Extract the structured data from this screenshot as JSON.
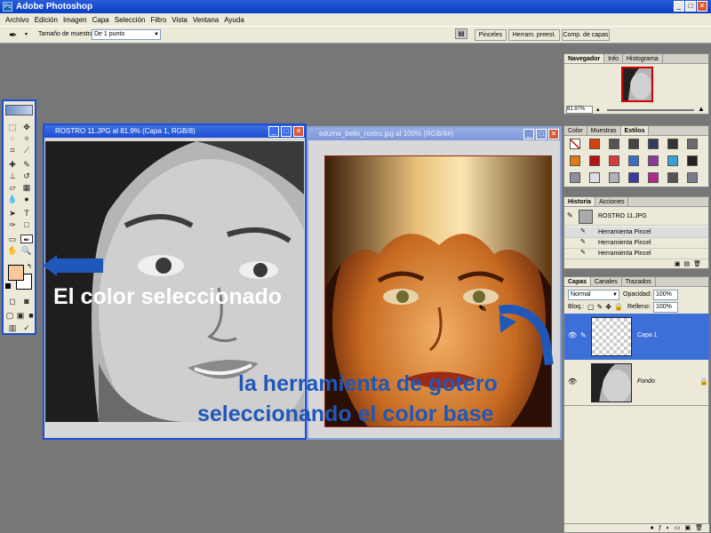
{
  "app": {
    "title": "Adobe Photoshop",
    "icon": "photoshop-icon"
  },
  "window_buttons": [
    "_",
    "□",
    "✕"
  ],
  "menu": [
    "Archivo",
    "Edición",
    "Imagen",
    "Capa",
    "Selección",
    "Filtro",
    "Vista",
    "Ventana",
    "Ayuda"
  ],
  "options": {
    "sample_label": "Tamaño de muestra:",
    "sample_value": "De 1 punto"
  },
  "palette_well": [
    "Pinceles",
    "Herram. preest.",
    "Comp. de capas"
  ],
  "docs": [
    {
      "title": "ROSTRO 11.JPG al 81.9% (Capa 1, RGB/8)"
    },
    {
      "title": "edurne_bello_rostro.jpg al 100% (RGB/8#)"
    }
  ],
  "navigator": {
    "tabs": [
      "Navegador",
      "Info",
      "Histograma"
    ],
    "zoom": "81.97%"
  },
  "styles": {
    "tabs": [
      "Color",
      "Muestras",
      "Estilos"
    ]
  },
  "history": {
    "tabs": [
      "Historia",
      "Acciones"
    ],
    "snapshot": "ROSTRO 11.JPG",
    "items": [
      "Herramienta Pincel",
      "Herramienta Pincel",
      "Herramienta Pincel"
    ]
  },
  "layers": {
    "tabs": [
      "Capas",
      "Canales",
      "Trazados"
    ],
    "blend_mode": "Normal",
    "opacity_label": "Opacidad:",
    "opacity_value": "100%",
    "lock_label": "Bloq.:",
    "fill_label": "Relleno:",
    "fill_value": "100%",
    "items": [
      {
        "name": "Capa 1"
      },
      {
        "name": "Fondo"
      }
    ]
  },
  "annotations": {
    "selected_color": "El color seleccionado",
    "eyedropper_line1": "la herramienta de gotero",
    "eyedropper_line2": "seleccionando el color base"
  },
  "colors": {
    "foreground": "#f6c99a",
    "accent": "#1f58b8",
    "title_blue": "#1c4fd6"
  }
}
